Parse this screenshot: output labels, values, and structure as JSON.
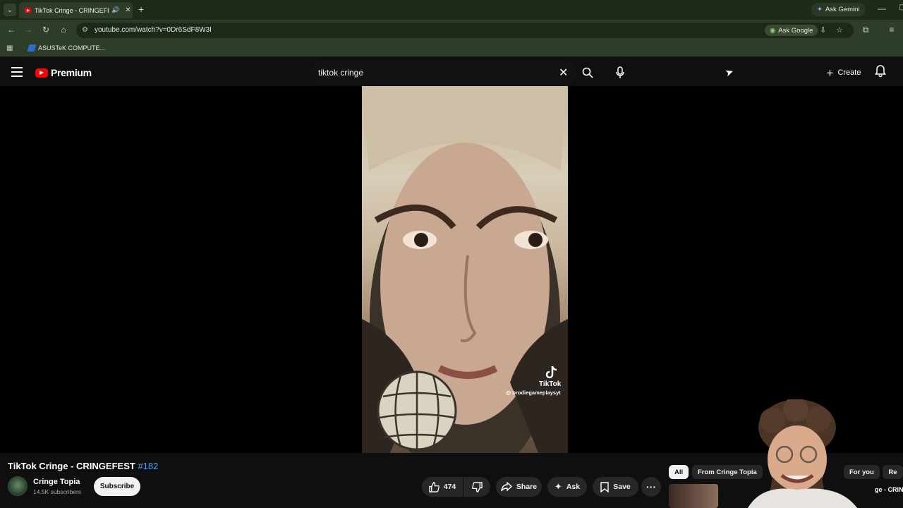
{
  "browser": {
    "tab_title": "TikTok Cringe - CRINGEFEST",
    "ask_gemini": "Ask Gemini",
    "url": "youtube.com/watch?v=0Dr6SdF8W3I",
    "ask_google": "Ask Google",
    "bookmark": "ASUSTeK COMPUTE..."
  },
  "header": {
    "logo_text": "Premium",
    "search_value": "tiktok cringe",
    "create_label": "Create"
  },
  "video": {
    "watermark_name": "TikTok",
    "watermark_user": "@ brodiegameplaysyt"
  },
  "details": {
    "title": "TikTok Cringe - CRINGEFEST",
    "hashtag": "#182",
    "channel": "Cringe Topia",
    "subscribers": "14.5K subscribers",
    "subscribe_label": "Subscribe",
    "likes": "474",
    "share_label": "Share",
    "ask_label": "Ask",
    "save_label": "Save"
  },
  "chips": [
    "All",
    "From Cringe Topia",
    "For you",
    "Re"
  ],
  "up_next_title": "ge - CRINGE",
  "colors": {
    "chrome_bg": "#2e3d27",
    "yt_bg": "#0f0f0f",
    "yt_red": "#ff0000",
    "hashtag_blue": "#3ea6ff"
  }
}
